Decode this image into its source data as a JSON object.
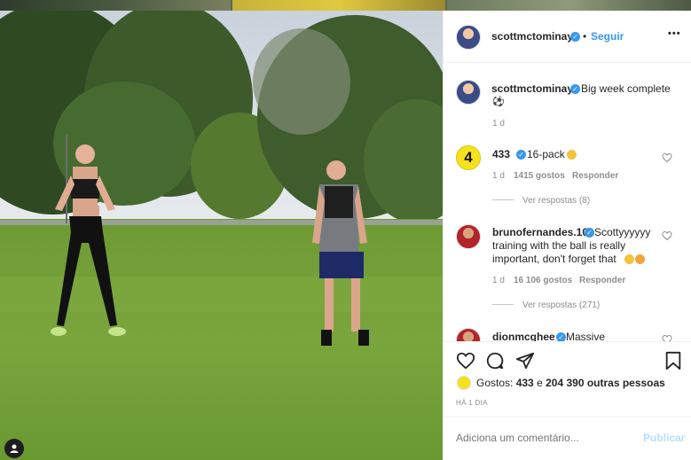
{
  "post": {
    "author": "scottmctominay",
    "follow_label": "Seguir",
    "more_label": "•••",
    "caption": "Big week complete",
    "caption_time": "1 d"
  },
  "comments": [
    {
      "user": "433",
      "text": "16-pack",
      "time": "1 d",
      "likes": "1415 gostos",
      "reply_label": "Responder",
      "view_replies": "Ver respostas (8)"
    },
    {
      "user": "brunofernandes.10",
      "text_line1": "Scottyyyyyy",
      "text_line2": "training with the ball is really",
      "text_line3": "important, don't forget that",
      "time": "1 d",
      "likes": "16 106 gostos",
      "reply_label": "Responder",
      "view_replies": "Ver respostas (271)"
    },
    {
      "user": "dionmcghee",
      "text": "Massive"
    }
  ],
  "likes_summary": {
    "prefix": "Gostos:",
    "count": "433",
    "connector": "e",
    "others": "204 390 outras pessoas"
  },
  "post_age": "HÁ 1 DIA",
  "add_comment": {
    "placeholder": "Adiciona um comentário...",
    "publish_label": "Publicar"
  },
  "colors": {
    "link_blue": "#3897f0",
    "publish_disabled": "#b2dffc",
    "verified_blue": "#3897f0"
  }
}
